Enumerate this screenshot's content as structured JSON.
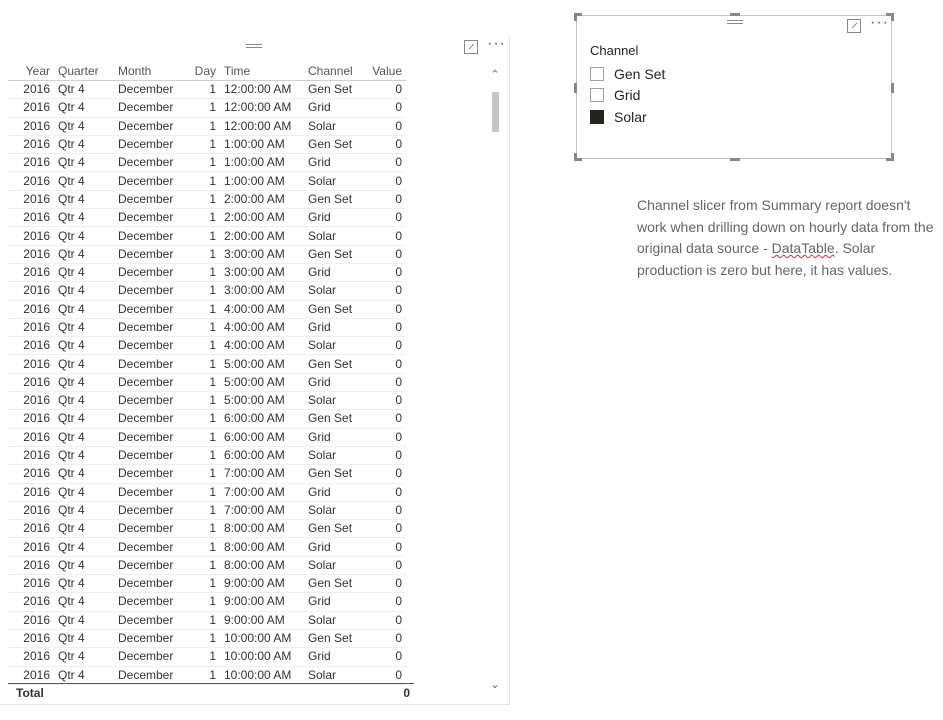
{
  "table": {
    "columns": [
      "Year",
      "Quarter",
      "Month",
      "Day",
      "Time",
      "Channel",
      "Value"
    ],
    "rows": [
      [
        "2016",
        "Qtr 4",
        "December",
        "1",
        "12:00:00 AM",
        "Gen Set",
        "0"
      ],
      [
        "2016",
        "Qtr 4",
        "December",
        "1",
        "12:00:00 AM",
        "Grid",
        "0"
      ],
      [
        "2016",
        "Qtr 4",
        "December",
        "1",
        "12:00:00 AM",
        "Solar",
        "0"
      ],
      [
        "2016",
        "Qtr 4",
        "December",
        "1",
        "1:00:00 AM",
        "Gen Set",
        "0"
      ],
      [
        "2016",
        "Qtr 4",
        "December",
        "1",
        "1:00:00 AM",
        "Grid",
        "0"
      ],
      [
        "2016",
        "Qtr 4",
        "December",
        "1",
        "1:00:00 AM",
        "Solar",
        "0"
      ],
      [
        "2016",
        "Qtr 4",
        "December",
        "1",
        "2:00:00 AM",
        "Gen Set",
        "0"
      ],
      [
        "2016",
        "Qtr 4",
        "December",
        "1",
        "2:00:00 AM",
        "Grid",
        "0"
      ],
      [
        "2016",
        "Qtr 4",
        "December",
        "1",
        "2:00:00 AM",
        "Solar",
        "0"
      ],
      [
        "2016",
        "Qtr 4",
        "December",
        "1",
        "3:00:00 AM",
        "Gen Set",
        "0"
      ],
      [
        "2016",
        "Qtr 4",
        "December",
        "1",
        "3:00:00 AM",
        "Grid",
        "0"
      ],
      [
        "2016",
        "Qtr 4",
        "December",
        "1",
        "3:00:00 AM",
        "Solar",
        "0"
      ],
      [
        "2016",
        "Qtr 4",
        "December",
        "1",
        "4:00:00 AM",
        "Gen Set",
        "0"
      ],
      [
        "2016",
        "Qtr 4",
        "December",
        "1",
        "4:00:00 AM",
        "Grid",
        "0"
      ],
      [
        "2016",
        "Qtr 4",
        "December",
        "1",
        "4:00:00 AM",
        "Solar",
        "0"
      ],
      [
        "2016",
        "Qtr 4",
        "December",
        "1",
        "5:00:00 AM",
        "Gen Set",
        "0"
      ],
      [
        "2016",
        "Qtr 4",
        "December",
        "1",
        "5:00:00 AM",
        "Grid",
        "0"
      ],
      [
        "2016",
        "Qtr 4",
        "December",
        "1",
        "5:00:00 AM",
        "Solar",
        "0"
      ],
      [
        "2016",
        "Qtr 4",
        "December",
        "1",
        "6:00:00 AM",
        "Gen Set",
        "0"
      ],
      [
        "2016",
        "Qtr 4",
        "December",
        "1",
        "6:00:00 AM",
        "Grid",
        "0"
      ],
      [
        "2016",
        "Qtr 4",
        "December",
        "1",
        "6:00:00 AM",
        "Solar",
        "0"
      ],
      [
        "2016",
        "Qtr 4",
        "December",
        "1",
        "7:00:00 AM",
        "Gen Set",
        "0"
      ],
      [
        "2016",
        "Qtr 4",
        "December",
        "1",
        "7:00:00 AM",
        "Grid",
        "0"
      ],
      [
        "2016",
        "Qtr 4",
        "December",
        "1",
        "7:00:00 AM",
        "Solar",
        "0"
      ],
      [
        "2016",
        "Qtr 4",
        "December",
        "1",
        "8:00:00 AM",
        "Gen Set",
        "0"
      ],
      [
        "2016",
        "Qtr 4",
        "December",
        "1",
        "8:00:00 AM",
        "Grid",
        "0"
      ],
      [
        "2016",
        "Qtr 4",
        "December",
        "1",
        "8:00:00 AM",
        "Solar",
        "0"
      ],
      [
        "2016",
        "Qtr 4",
        "December",
        "1",
        "9:00:00 AM",
        "Gen Set",
        "0"
      ],
      [
        "2016",
        "Qtr 4",
        "December",
        "1",
        "9:00:00 AM",
        "Grid",
        "0"
      ],
      [
        "2016",
        "Qtr 4",
        "December",
        "1",
        "9:00:00 AM",
        "Solar",
        "0"
      ],
      [
        "2016",
        "Qtr 4",
        "December",
        "1",
        "10:00:00 AM",
        "Gen Set",
        "0"
      ],
      [
        "2016",
        "Qtr 4",
        "December",
        "1",
        "10:00:00 AM",
        "Grid",
        "0"
      ],
      [
        "2016",
        "Qtr 4",
        "December",
        "1",
        "10:00:00 AM",
        "Solar",
        "0"
      ]
    ],
    "total_label": "Total",
    "total_value": "0"
  },
  "slicer": {
    "title": "Channel",
    "items": [
      {
        "label": "Gen Set",
        "checked": false
      },
      {
        "label": "Grid",
        "checked": false
      },
      {
        "label": "Solar",
        "checked": true
      }
    ]
  },
  "note": {
    "text_before": "Channel slicer from Summary report doesn't work when drilling down on hourly data from the original data source - ",
    "underlined": "DataTable",
    "text_after": ".  Solar production is zero but here, it has values."
  },
  "icons": {
    "grip": "drag-grip-icon",
    "focus": "focus-mode-icon",
    "more": "more-options-icon",
    "scroll_up": "chevron-up-icon",
    "scroll_down": "chevron-down-icon"
  },
  "colors": {
    "text": "#252423",
    "note_text": "#666666",
    "border": "#c8c6c4",
    "checked_fill": "#252423",
    "spell_underline": "#d13438"
  }
}
